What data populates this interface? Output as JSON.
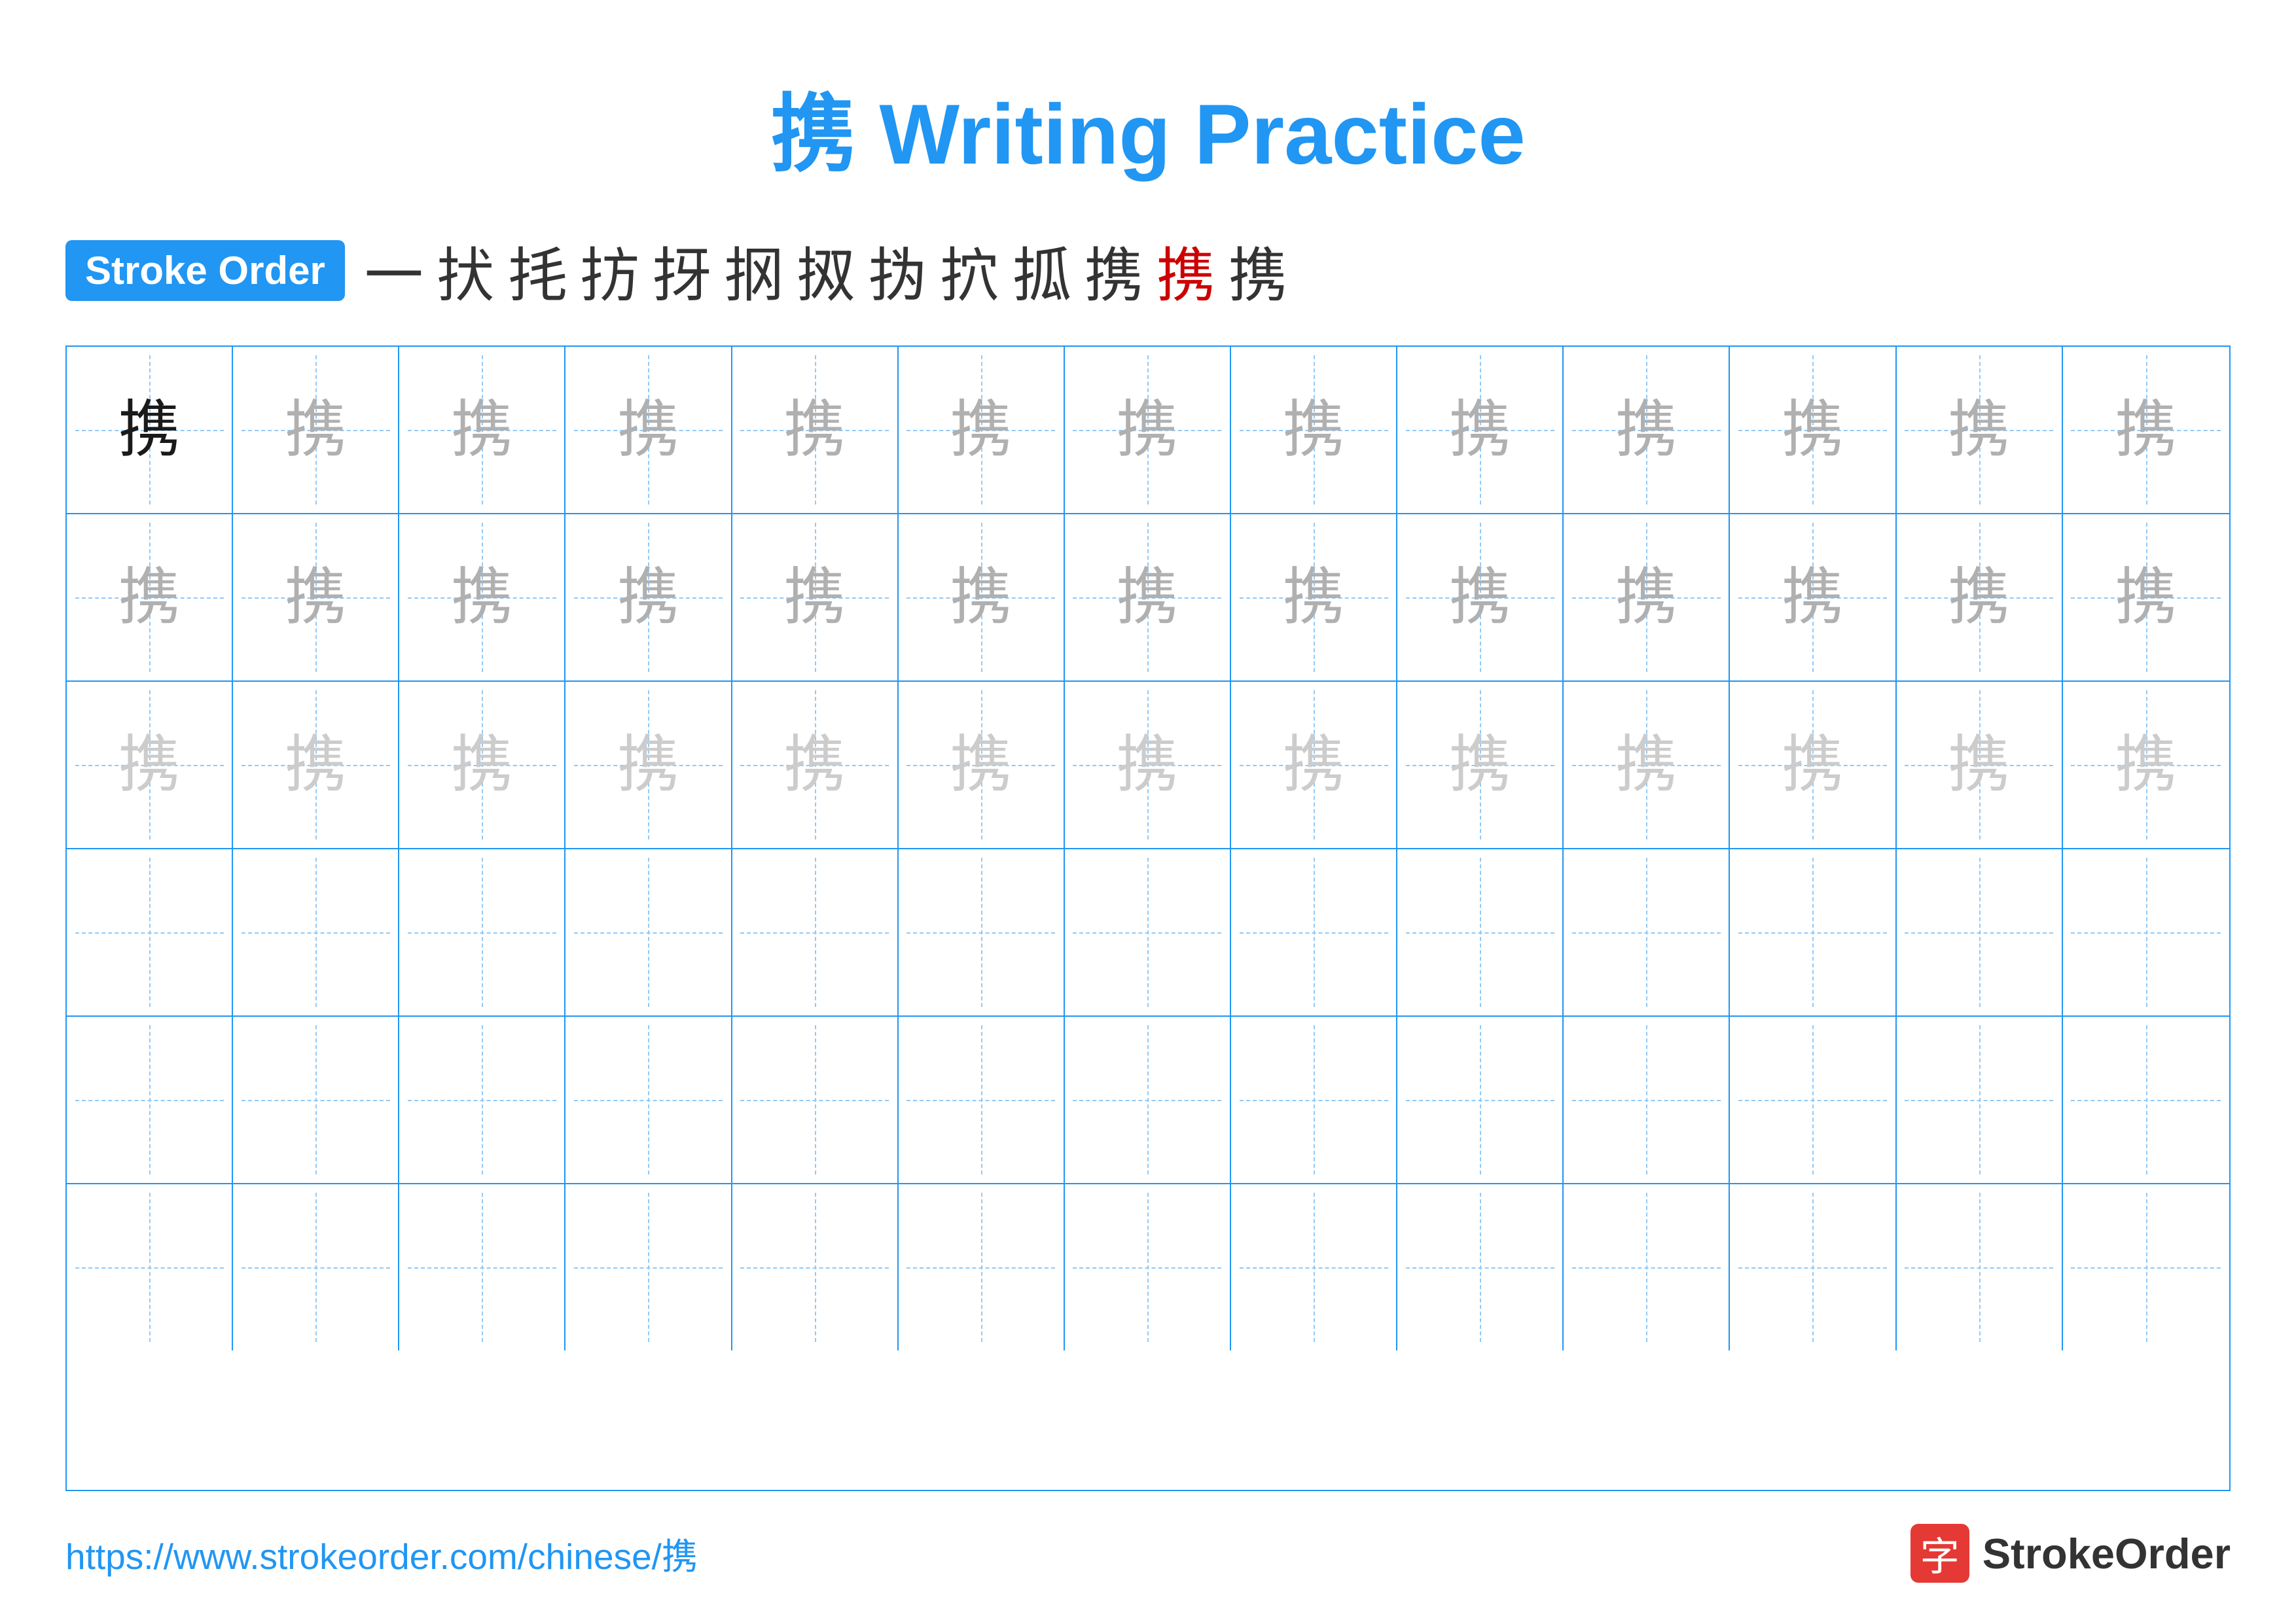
{
  "title": "携 Writing Practice",
  "stroke_order": {
    "badge_label": "Stroke Order",
    "strokes": [
      "一",
      "㧋",
      "㧌",
      "㧍",
      "㧎",
      "㧏",
      "㧐",
      "㧑",
      "㧒",
      "㧓",
      "㧔",
      "携",
      "携"
    ]
  },
  "grid": {
    "rows": 6,
    "cols": 13,
    "char": "携",
    "row_types": [
      "dark",
      "light1",
      "light2",
      "empty",
      "empty",
      "empty"
    ]
  },
  "footer": {
    "url": "https://www.strokeorder.com/chinese/携",
    "logo_char": "字",
    "logo_name": "StrokeOrder"
  }
}
